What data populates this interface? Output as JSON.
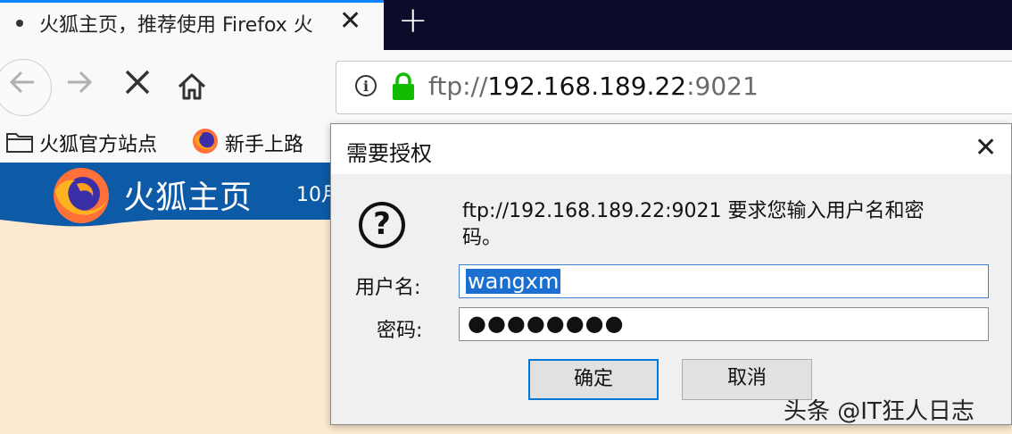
{
  "browser": {
    "tab": {
      "title": "火狐主页，推荐使用 Firefox 火"
    },
    "url": {
      "dim_prefix": "ftp://",
      "host": "192.168.189.22",
      "port": ":9021"
    },
    "bookmarks": [
      {
        "label": "火狐官方站点",
        "icon": "folder-icon"
      },
      {
        "label": "新手上路",
        "icon": "firefox-icon"
      }
    ]
  },
  "page": {
    "title": "火狐主页",
    "date_fragment": "10月"
  },
  "dialog": {
    "title": "需要授权",
    "message": "ftp://192.168.189.22:9021 要求您输入用户名和密码。",
    "username_label": "用户名:",
    "password_label": "密码:",
    "username_value": "wangxm",
    "password_value": "●●●●●●●●",
    "ok_label": "确定",
    "cancel_label": "取消"
  },
  "watermark": "头条 @IT狂人日志",
  "colors": {
    "tabstrip": "#0c0c2a",
    "banner": "#0d5aa7",
    "page_bg": "#fde9d0",
    "lock": "#12bc00",
    "selection": "#1a6fd0"
  }
}
